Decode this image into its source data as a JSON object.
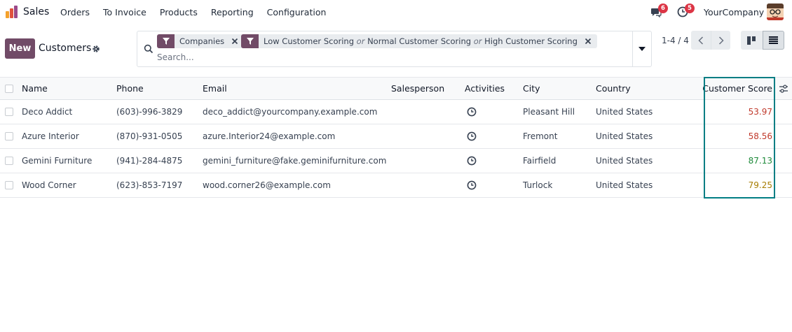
{
  "navbar": {
    "app_name": "Sales",
    "menu": [
      "Orders",
      "To Invoice",
      "Products",
      "Reporting",
      "Configuration"
    ],
    "messages_count": "6",
    "activities_count": "5",
    "company": "YourCompany"
  },
  "control": {
    "new_label": "New",
    "title": "Customers",
    "facets": [
      {
        "parts": [
          "Companies"
        ]
      },
      {
        "parts": [
          "Low Customer Scoring",
          "or",
          "Normal Customer Scoring",
          "or",
          "High Customer Scoring"
        ]
      }
    ],
    "search_placeholder": "Search...",
    "pager": "1-4 / 4"
  },
  "table": {
    "columns": [
      "Name",
      "Phone",
      "Email",
      "Salesperson",
      "Activities",
      "City",
      "Country",
      "Customer Score"
    ],
    "rows": [
      {
        "name": "Deco Addict",
        "phone": "(603)-996-3829",
        "email": "deco_addict@yourcompany.example.com",
        "salesperson": "",
        "city": "Pleasant Hill",
        "country": "United States",
        "score": "53.97",
        "score_color": "#c0392b"
      },
      {
        "name": "Azure Interior",
        "phone": "(870)-931-0505",
        "email": "azure.Interior24@example.com",
        "salesperson": "",
        "city": "Fremont",
        "country": "United States",
        "score": "58.56",
        "score_color": "#c0392b"
      },
      {
        "name": "Gemini Furniture",
        "phone": "(941)-284-4875",
        "email": "gemini_furniture@fake.geminifurniture.com",
        "salesperson": "",
        "city": "Fairfield",
        "country": "United States",
        "score": "87.13",
        "score_color": "#1e8a3a"
      },
      {
        "name": "Wood Corner",
        "phone": "(623)-853-7197",
        "email": "wood.corner26@example.com",
        "salesperson": "",
        "city": "Turlock",
        "country": "United States",
        "score": "79.25",
        "score_color": "#a67c00"
      }
    ]
  },
  "colors": {
    "brand": "#714b67",
    "highlight": "#017e84",
    "badge": "#dc3545"
  }
}
